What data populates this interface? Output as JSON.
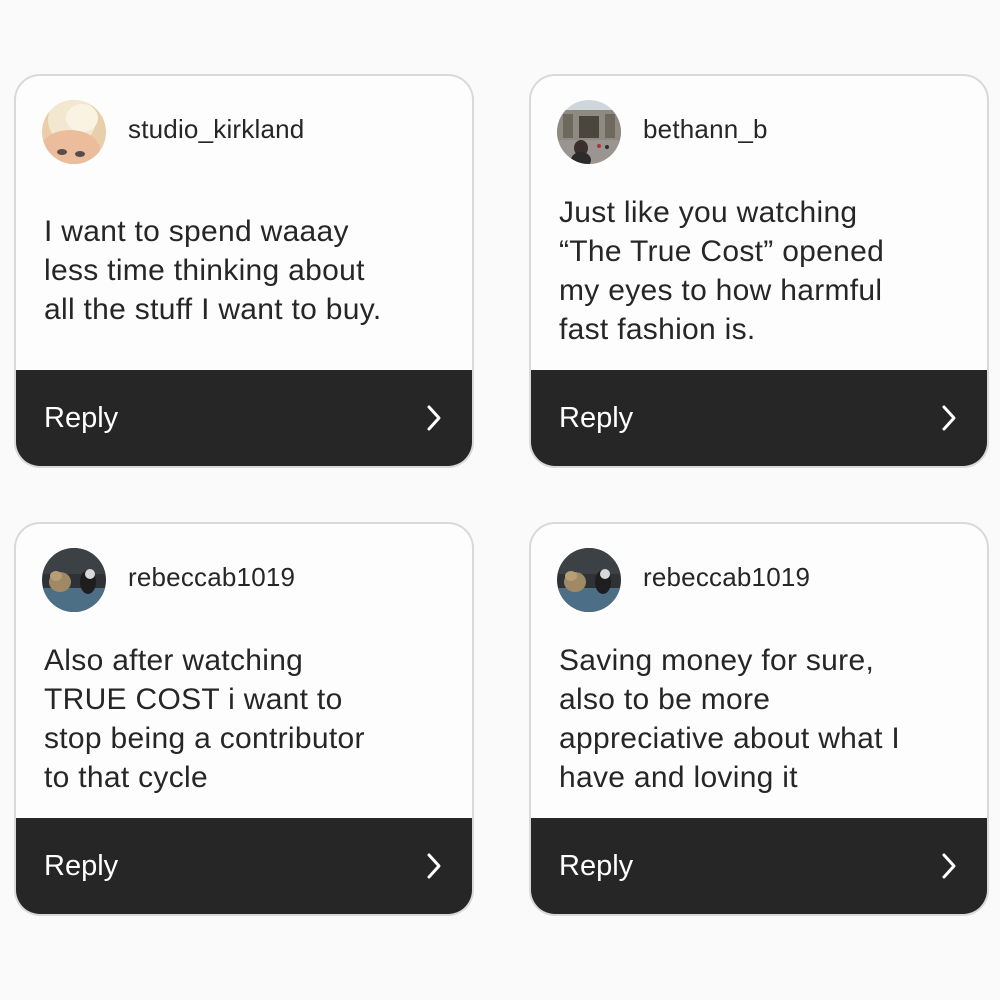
{
  "cards": [
    {
      "username": "studio_kirkland",
      "message": "I want to spend waaay\nless time  thinking about\nall the stuff I want to buy.",
      "reply_label": "Reply",
      "avatar_icon": "baby-face-avatar"
    },
    {
      "username": "bethann_b",
      "message": "Just like you watching\n“The True Cost” opened\nmy eyes to how harmful\nfast fashion is.",
      "reply_label": "Reply",
      "avatar_icon": "palace-gate-photo-avatar"
    },
    {
      "username": "rebeccab1019",
      "message": "Also after watching\nTRUE COST i want to\nstop being a contributor\nto that cycle",
      "reply_label": "Reply",
      "avatar_icon": "dogs-on-floor-avatar"
    },
    {
      "username": "rebeccab1019",
      "message": "Saving money for sure,\nalso to be more\nappreciative about what I\nhave and loving it",
      "reply_label": "Reply",
      "avatar_icon": "dogs-on-floor-avatar"
    }
  ],
  "colors": {
    "page_background": "#fafafa",
    "card_background": "#fdfdfd",
    "card_border": "#d9d9d9",
    "text": "#262626",
    "reply_bar": "#262626",
    "reply_text": "#ffffff"
  }
}
